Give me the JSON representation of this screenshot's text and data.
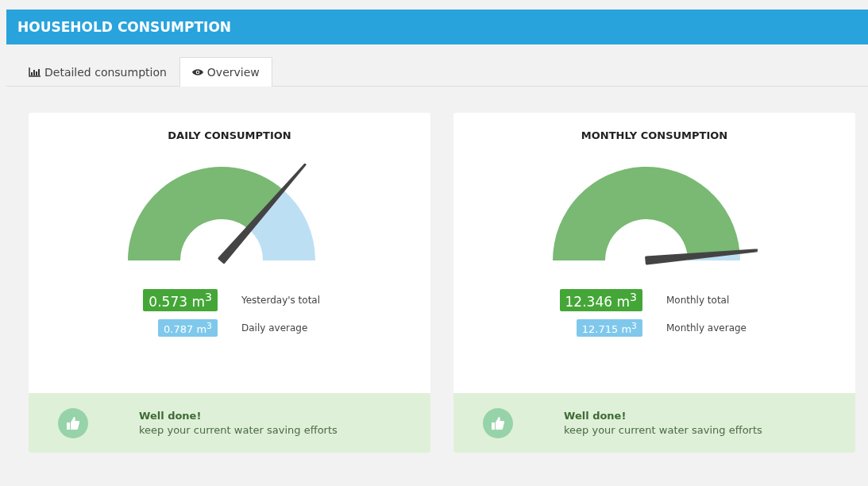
{
  "header": {
    "title": "HOUSEHOLD CONSUMPTION"
  },
  "tabs": [
    {
      "label": "Detailed consumption",
      "selected": false
    },
    {
      "label": "Overview",
      "selected": true
    }
  ],
  "cards": [
    {
      "title": "DAILY CONSUMPTION",
      "gauge": {
        "level": 0.728
      },
      "total": {
        "value": "0.573 m$^{3}$",
        "label": "Yesterday's total"
      },
      "average": {
        "value": "0.787 m$^{3}$",
        "label": "Daily average"
      },
      "message": {
        "heading": "Well done!",
        "text": "keep your current water saving efforts"
      }
    },
    {
      "title": "MONTHLY CONSUMPTION",
      "gauge": {
        "level": 0.971
      },
      "total": {
        "value": "12.346 m$^{3}$",
        "label": "Monthly total"
      },
      "average": {
        "value": "12.715 m$^{3}$",
        "label": "Monthly average"
      },
      "message": {
        "heading": "Well done!",
        "text": "keep your current water saving efforts"
      }
    }
  ]
}
